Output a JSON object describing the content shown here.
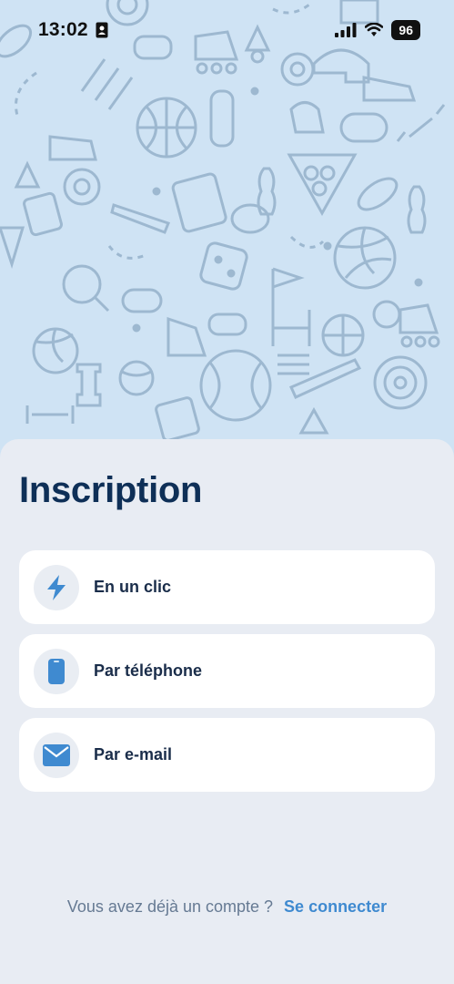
{
  "status_bar": {
    "time": "13:02",
    "battery_level": "96",
    "icons": [
      "contact-card-icon",
      "cellular-signal-icon",
      "wifi-icon",
      "battery-icon"
    ]
  },
  "hero": {
    "pattern_theme": "sports-icons-pattern",
    "background_color": "#cfe3f4",
    "icon_color": "#9db8d0"
  },
  "signup": {
    "title": "Inscription",
    "options": [
      {
        "label": "En un clic",
        "icon": "lightning-bolt-icon"
      },
      {
        "label": "Par téléphone",
        "icon": "phone-icon"
      },
      {
        "label": "Par e-mail",
        "icon": "envelope-icon"
      }
    ]
  },
  "footer": {
    "prompt": "Vous avez déjà un compte ?",
    "login_link": "Se connecter"
  },
  "colors": {
    "title": "#0e2f57",
    "accent": "#3f8ad0",
    "sheet_bg": "#e8ecf3"
  }
}
